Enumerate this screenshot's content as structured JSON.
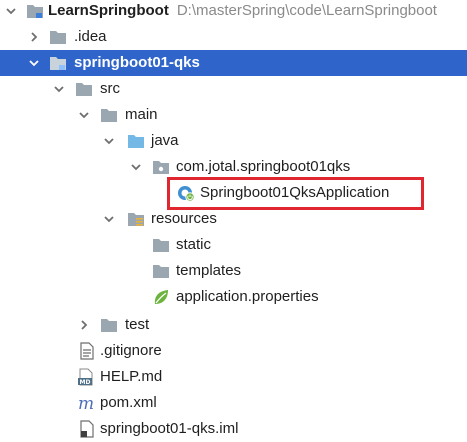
{
  "tree": {
    "root": {
      "label": "LearnSpringboot",
      "path": "D:\\masterSpring\\code\\LearnSpringboot"
    },
    "idea": {
      "label": ".idea"
    },
    "module": {
      "label": "springboot01-qks"
    },
    "src": {
      "label": "src"
    },
    "main": {
      "label": "main"
    },
    "java": {
      "label": "java"
    },
    "package": {
      "label": "com.jotal.springboot01qks"
    },
    "app_class": {
      "label": "Springboot01QksApplication"
    },
    "resources": {
      "label": "resources"
    },
    "static": {
      "label": "static"
    },
    "templates": {
      "label": "templates"
    },
    "app_properties": {
      "label": "application.properties"
    },
    "test": {
      "label": "test"
    },
    "gitignore": {
      "label": ".gitignore"
    },
    "help": {
      "label": "HELP.md"
    },
    "pom": {
      "label": "pom.xml"
    },
    "iml": {
      "label": "springboot01-qks.iml"
    }
  },
  "colors": {
    "selection": "#2f65ca",
    "folder": "#9aa7b0",
    "java_folder": "#74b9e5",
    "highlight_border": "#e0262e",
    "spring_green": "#6db33f"
  }
}
